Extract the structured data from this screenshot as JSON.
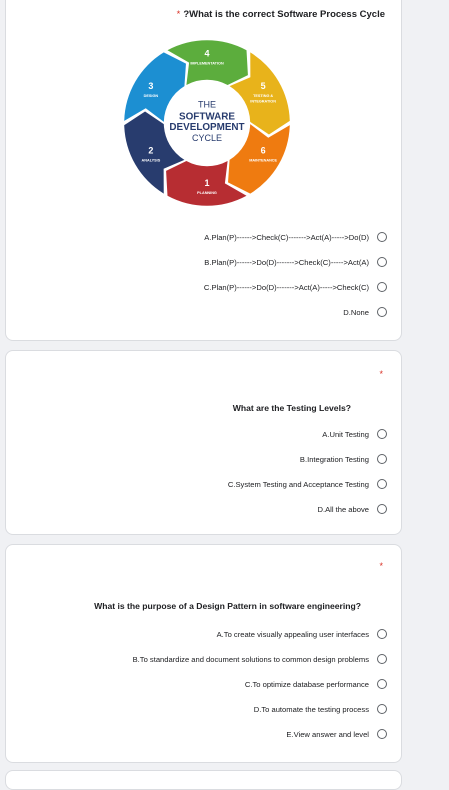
{
  "required_marker": "*",
  "questions": [
    {
      "title": "?What is the correct Software Process Cycle",
      "cycle": {
        "center_line1": "THE",
        "center_line2": "SOFTWARE",
        "center_line3": "DEVELOPMENT",
        "center_line4": "CYCLE",
        "stages": [
          {
            "num": "1",
            "label": "PLANNING",
            "color": "#b72d32"
          },
          {
            "num": "2",
            "label": "ANALYSIS",
            "color": "#283c6e"
          },
          {
            "num": "3",
            "label": "DESIGN",
            "color": "#1c8fd2"
          },
          {
            "num": "4",
            "label": "IMPLEMENTATION",
            "color": "#5cad3d"
          },
          {
            "num": "5",
            "label": "TESTING & INTEGRATION",
            "color": "#e8b31b"
          },
          {
            "num": "6",
            "label": "MAINTENANCE",
            "color": "#ef7b10"
          }
        ]
      },
      "options": [
        "A.Plan(P)------>Check(C)------->Act(A)----->Do(D)",
        "B.Plan(P)------>Do(D)------->Check(C)----->Act(A)",
        "C.Plan(P)------>Do(D)------->Act(A)----->Check(C)",
        "D.None"
      ]
    },
    {
      "title": "What are the Testing Levels?",
      "options": [
        "A.Unit Testing",
        "B.Integration Testing",
        "C.System Testing and Acceptance Testing",
        "D.All the above"
      ]
    },
    {
      "title": "What is the purpose of a Design Pattern in software engineering?",
      "options": [
        "A.To create visually appealing user interfaces",
        "B.To standardize and document solutions to common design problems",
        "C.To optimize database performance",
        "D.To automate the testing process",
        "E.View answer and level"
      ]
    }
  ]
}
